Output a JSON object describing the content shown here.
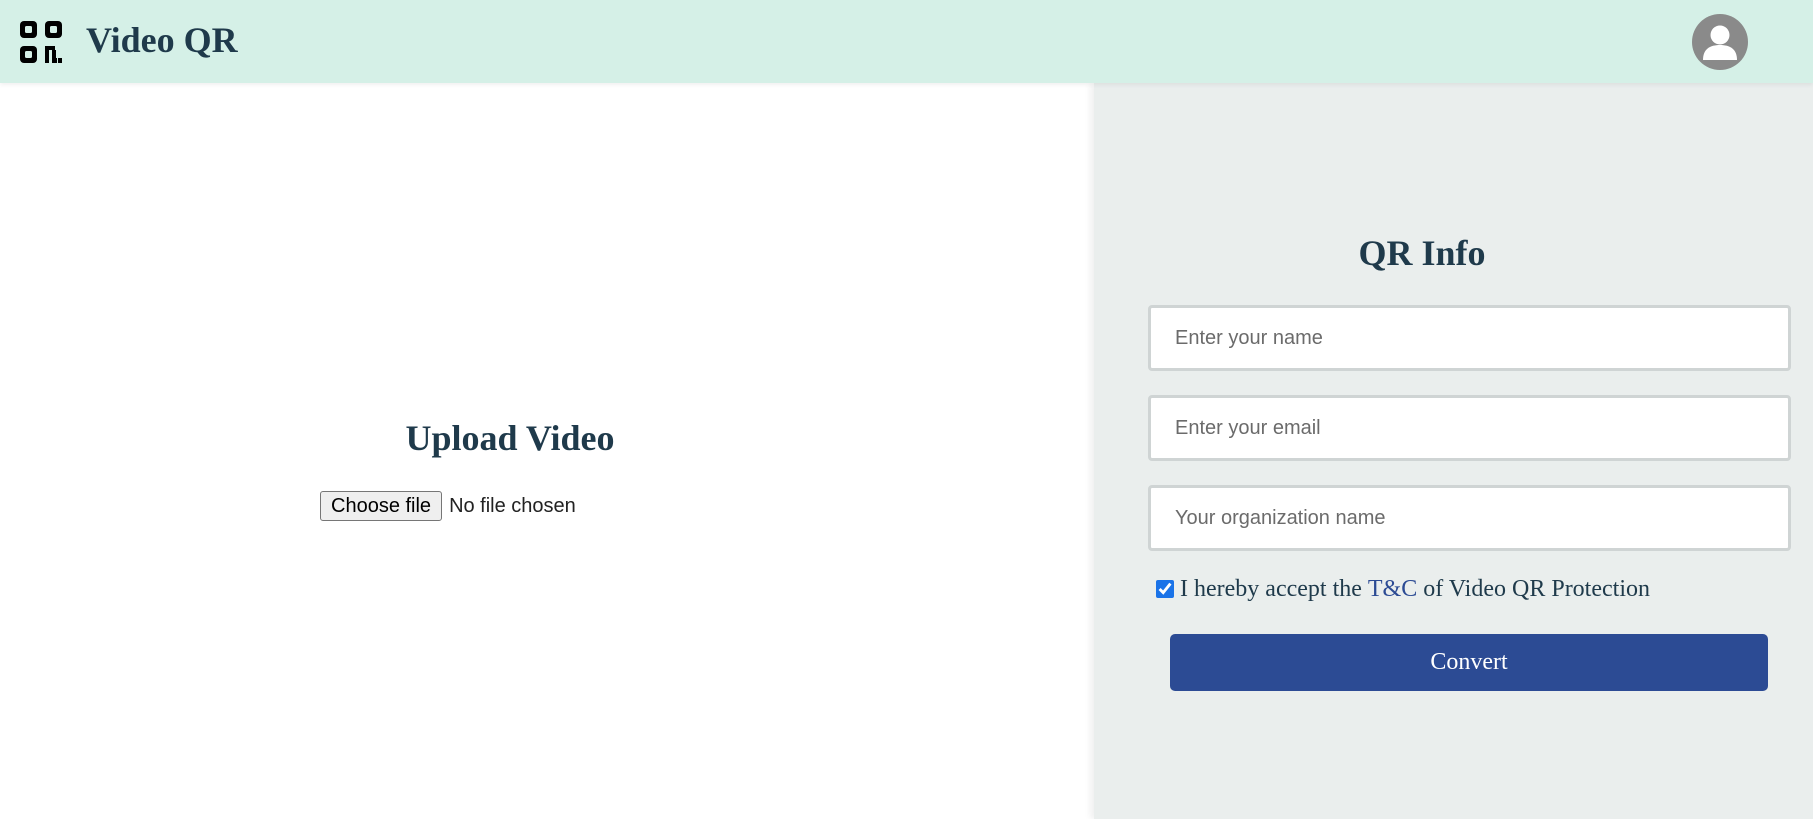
{
  "header": {
    "app_title": "Video QR",
    "logo_icon": "qr-code-icon",
    "avatar_icon": "user-avatar-icon",
    "background_color": "#d5f0e7"
  },
  "upload": {
    "title": "Upload Video",
    "choose_file_label": "Choose file",
    "file_status": "No file chosen"
  },
  "qr_info": {
    "title": "QR Info",
    "name_placeholder": "Enter your name",
    "name_value": "",
    "email_placeholder": "Enter your email",
    "email_value": "",
    "organization_placeholder": "Your organization name",
    "organization_value": "",
    "terms": {
      "checked": true,
      "prefix": "I hereby accept the",
      "link_text": "T&C",
      "suffix": "of Video QR Protection"
    },
    "convert_label": "Convert",
    "accent_color": "#2c4b94"
  }
}
